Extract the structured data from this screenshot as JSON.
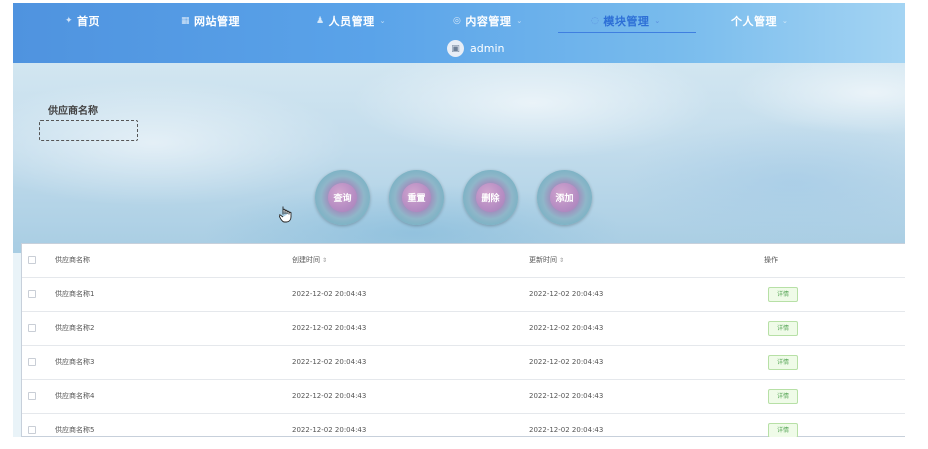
{
  "nav": {
    "items": [
      {
        "label": "首页",
        "icon": "home-icon",
        "glyph": "✦"
      },
      {
        "label": "网站管理",
        "icon": "site-icon",
        "glyph": "▦"
      },
      {
        "label": "人员管理",
        "icon": "person-icon",
        "glyph": "♟"
      },
      {
        "label": "内容管理",
        "icon": "content-icon",
        "glyph": "◎"
      },
      {
        "label": "模块管理",
        "icon": "module-icon",
        "glyph": "◌"
      },
      {
        "label": "个人管理",
        "icon": "personal-icon",
        "glyph": ""
      }
    ],
    "active_item": "模块管理",
    "chevron": "⌄"
  },
  "user": {
    "name": "admin",
    "avatar_icon": "image-icon",
    "avatar_glyph": "▣"
  },
  "search": {
    "label": "供应商名称",
    "value": "",
    "placeholder": ""
  },
  "actions": {
    "query": "查询",
    "reset": "重置",
    "delete": "删除",
    "add": "添加"
  },
  "table": {
    "columns": {
      "name": "供应商名称",
      "create_time": "创建时间",
      "update_time": "更新时间",
      "operation": "操作"
    },
    "sort_icon": "⇕",
    "detail_label": "详情",
    "rows": [
      {
        "name": "供应商名称1",
        "create_time": "2022-12-02 20:04:43",
        "update_time": "2022-12-02 20:04:43"
      },
      {
        "name": "供应商名称2",
        "create_time": "2022-12-02 20:04:43",
        "update_time": "2022-12-02 20:04:43"
      },
      {
        "name": "供应商名称3",
        "create_time": "2022-12-02 20:04:43",
        "update_time": "2022-12-02 20:04:43"
      },
      {
        "name": "供应商名称4",
        "create_time": "2022-12-02 20:04:43",
        "update_time": "2022-12-02 20:04:43"
      },
      {
        "name": "供应商名称5",
        "create_time": "2022-12-02 20:04:43",
        "update_time": "2022-12-02 20:04:43"
      }
    ]
  },
  "colors": {
    "nav_start": "#4f93df",
    "nav_end": "#a4d4f3",
    "active_nav": "#2d6fd6",
    "detail_green": "#5aa85a"
  }
}
